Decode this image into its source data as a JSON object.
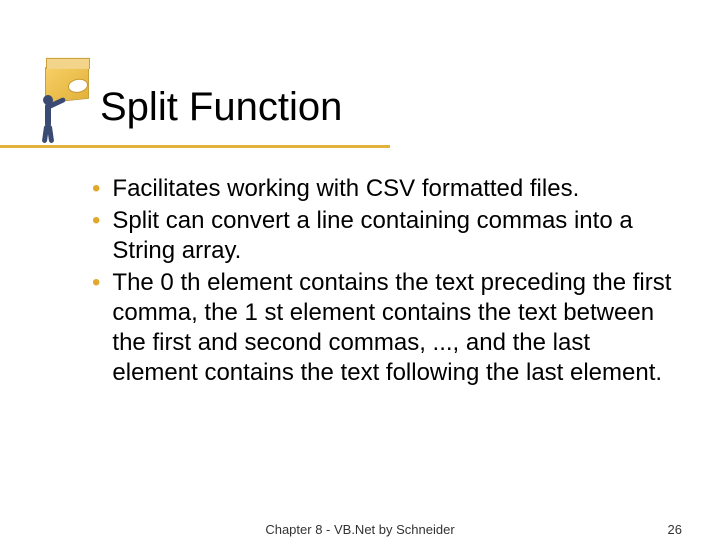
{
  "title": "Split Function",
  "bullets": [
    "Facilitates working with CSV formatted files.",
    "Split can convert a line containing commas into a String array.",
    "The 0 th element contains the text preceding the first comma, the 1 st element contains the text between the first and second commas, ..., and the last element contains the text following the last element."
  ],
  "footer": {
    "center": "Chapter 8 - VB.Net by Schneider",
    "page": "26"
  }
}
